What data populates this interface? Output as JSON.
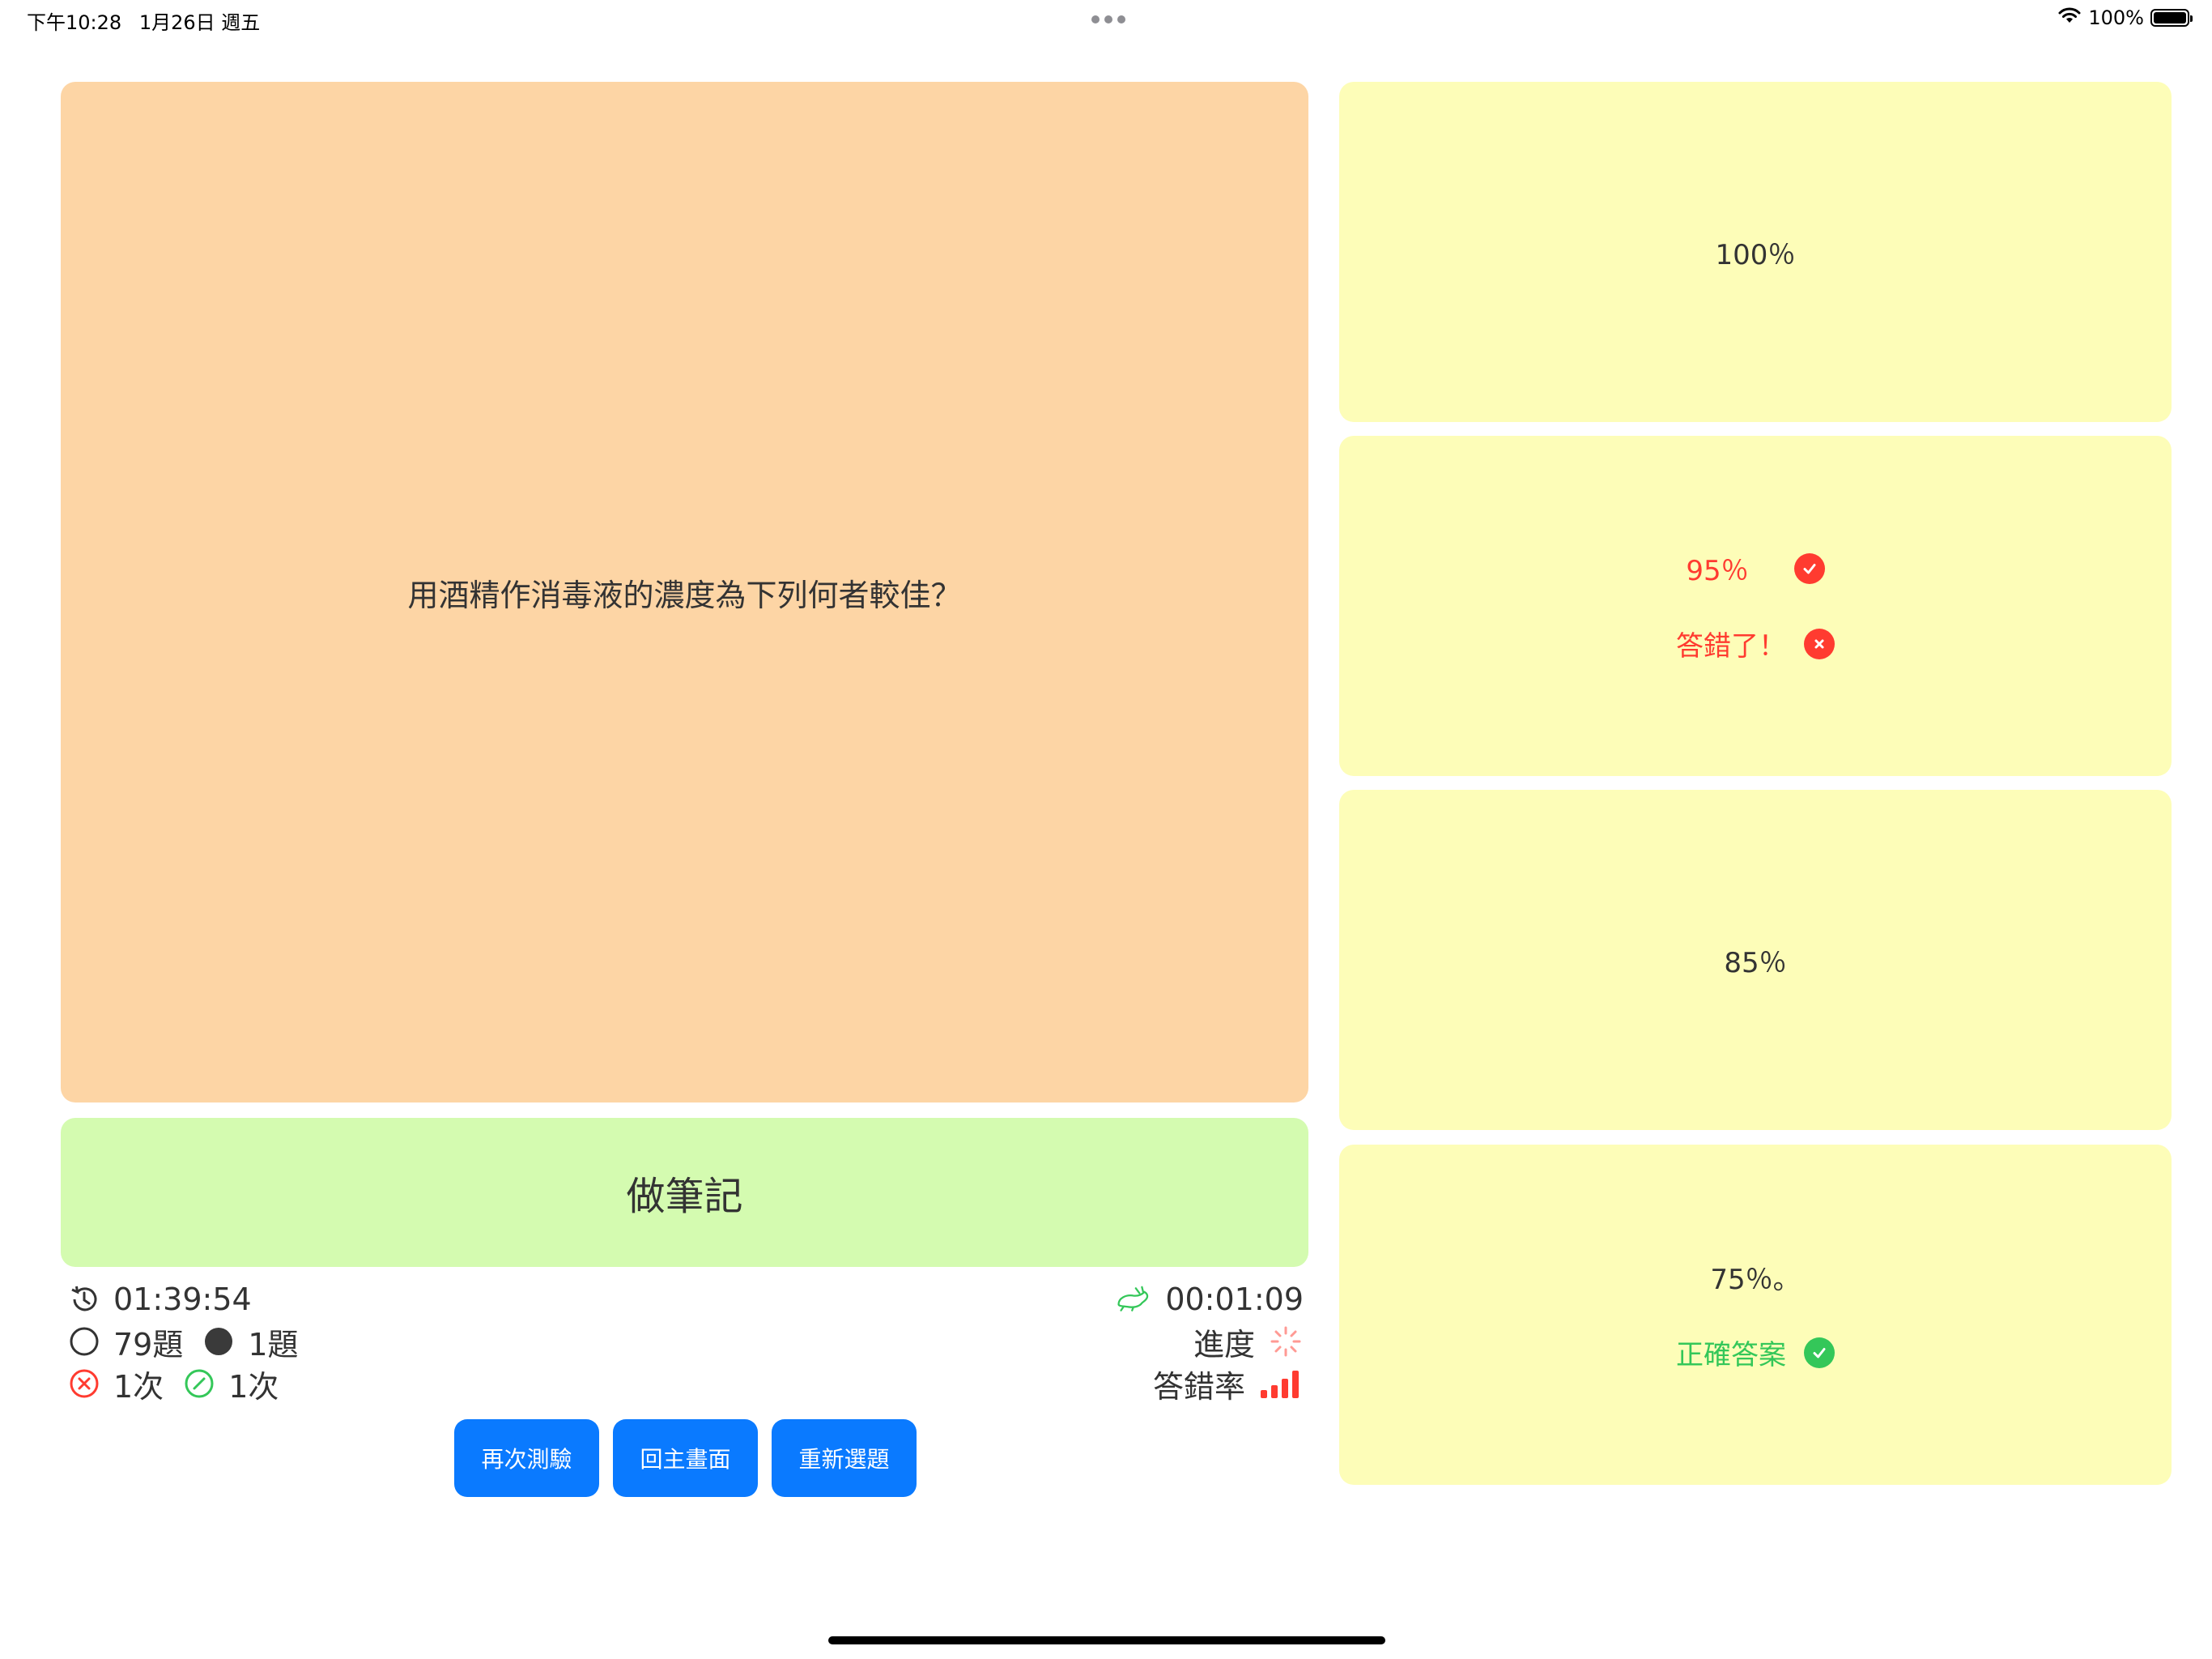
{
  "status_bar": {
    "time": "下午10:28",
    "date": "1月26日 週五",
    "battery": "100%",
    "battery_level": 1.0
  },
  "question": {
    "text": "用酒精作消毒液的濃度為下列何者較佳？"
  },
  "notes_button": {
    "label": "做筆記"
  },
  "stats": {
    "total_time": "01:39:54",
    "unanswered": "79題",
    "answered": "1題",
    "wrong_count": "1次",
    "correct_count": "1次",
    "question_time": "00:01:09",
    "progress_label": "進度",
    "error_rate_label": "答錯率"
  },
  "actions": {
    "retry": "再次測驗",
    "home": "回主畫面",
    "reselect": "重新選題"
  },
  "options": [
    {
      "text": "100％",
      "status": ""
    },
    {
      "text": "95％",
      "status": "答錯了！"
    },
    {
      "text": "85％",
      "status": ""
    },
    {
      "text": "75％。",
      "status": "正確答案"
    }
  ],
  "colors": {
    "question_bg": "#fdd5a5",
    "notes_bg": "#d4fbb0",
    "option_bg": "#fdfdb8",
    "button_blue": "#0a7aff",
    "wrong_red": "#ff3b30",
    "correct_green": "#34c759"
  }
}
